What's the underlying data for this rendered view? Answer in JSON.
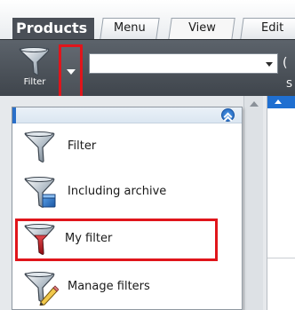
{
  "header": {
    "app_title": "Products",
    "tabs": [
      {
        "label": "Menu"
      },
      {
        "label": "View"
      },
      {
        "label": "Edit"
      }
    ]
  },
  "ribbon": {
    "filter_button_label": "Filter",
    "combo_value": "",
    "combo_trailing_glyph": "(",
    "section_letter": "S"
  },
  "menu": {
    "items": [
      {
        "label": "Filter",
        "icon": "funnel-icon"
      },
      {
        "label": "Including archive",
        "icon": "funnel-archive-icon"
      },
      {
        "label": "My filter",
        "icon": "funnel-red-icon"
      },
      {
        "label": "Manage filters",
        "icon": "funnel-pencil-icon"
      }
    ]
  },
  "colors": {
    "highlight_red": "#e0151b",
    "ribbon_dark": "#4a4f57",
    "accent_blue": "#1f6fd1"
  }
}
